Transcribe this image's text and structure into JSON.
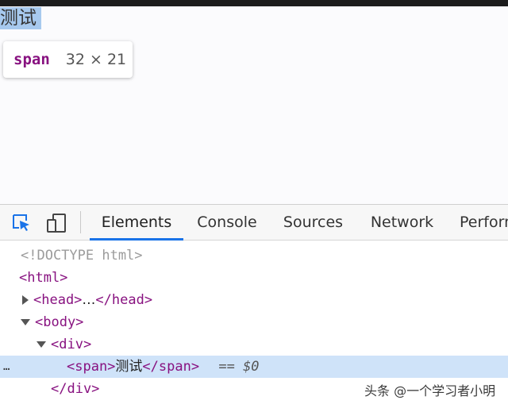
{
  "page": {
    "selected_text": "测试",
    "tooltip": {
      "tag": "span",
      "size": "32 × 21"
    }
  },
  "devtools": {
    "icons": {
      "inspect": "inspect-element-icon",
      "device": "device-toolbar-icon"
    },
    "tabs": [
      {
        "label": "Elements",
        "active": true
      },
      {
        "label": "Console"
      },
      {
        "label": "Sources"
      },
      {
        "label": "Network"
      },
      {
        "label": "Perform"
      }
    ],
    "dom": {
      "doctype": "<!DOCTYPE html>",
      "html_open": "<html>",
      "head_open": "<head>",
      "head_ellipsis": "…",
      "head_close": "</head>",
      "body_open": "<body>",
      "div_open": "<div>",
      "span_open": "<span>",
      "span_text": "测试",
      "span_close": "</span>",
      "eq_marker": "==",
      "dollar_ref": "$0",
      "div_close": "</div>",
      "row_menu": "…"
    },
    "accent": "#1a73e8",
    "selected_row_color": "#cfe3f9"
  },
  "watermark": "头条 @一个学习者小明"
}
